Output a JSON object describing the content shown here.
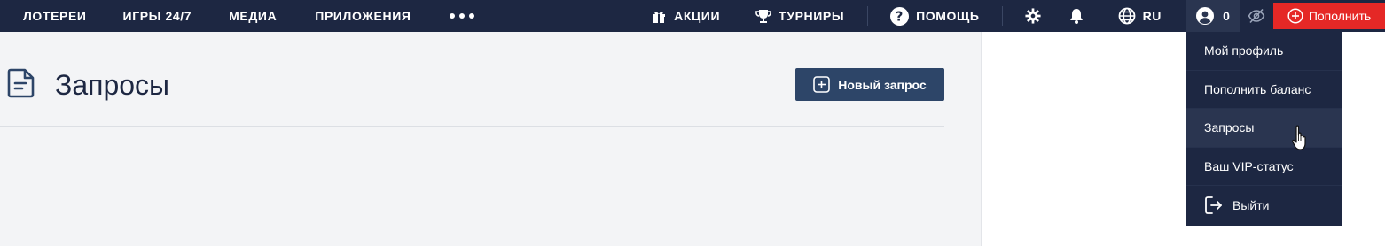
{
  "topnav": {
    "items": [
      "ЛОТЕРЕИ",
      "ИГРЫ 24/7",
      "МЕДИА",
      "ПРИЛОЖЕНИЯ"
    ],
    "more_icon": "more-dots-icon",
    "promos_label": "АКЦИИ",
    "tournaments_label": "ТУРНИРЫ",
    "help_label": "ПОМОЩЬ",
    "language": "RU",
    "profile_count": "0",
    "deposit_label": "Пополнить"
  },
  "page": {
    "title": "Запросы",
    "new_request_label": "Новый запрос"
  },
  "profile_menu": {
    "items": [
      "Мой профиль",
      "Пополнить баланс",
      "Запросы",
      "Ваш VIP-статус"
    ],
    "logout_label": "Выйти",
    "hovered_index": 2
  },
  "colors": {
    "nav_bg": "#1d2742",
    "deposit_red": "#e52826",
    "primary_btn": "#2d4568",
    "page_bg": "#f3f4f6"
  }
}
